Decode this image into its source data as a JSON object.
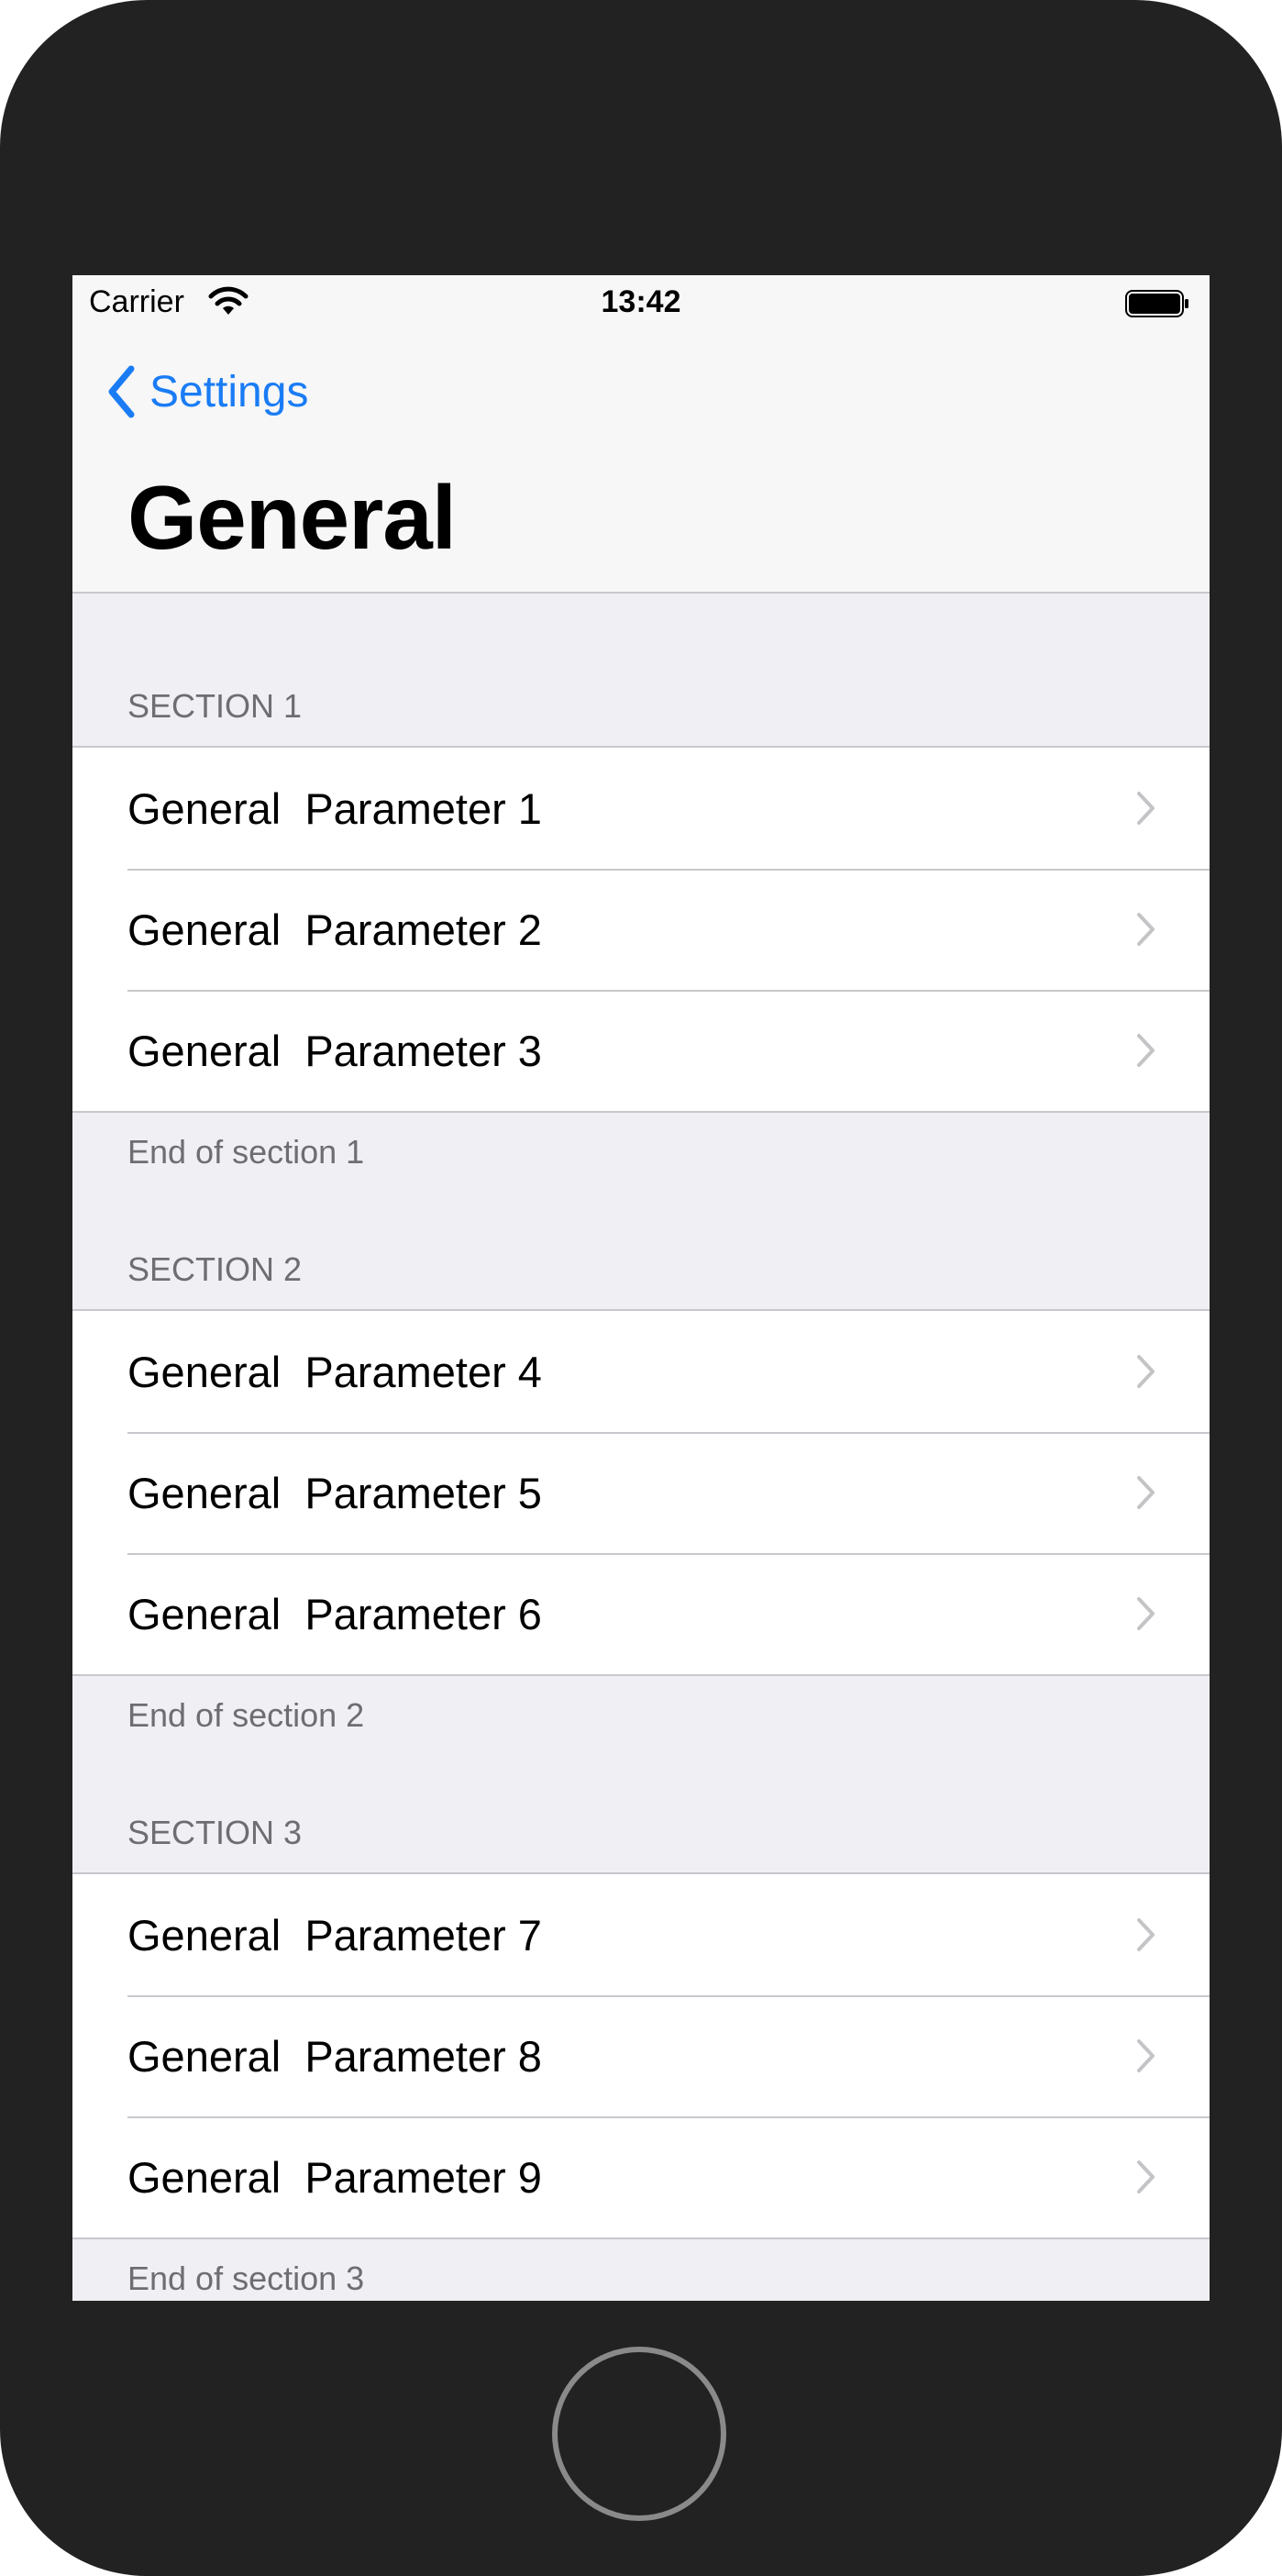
{
  "status_bar": {
    "carrier": "Carrier",
    "time": "13:42"
  },
  "nav": {
    "back_label": "Settings",
    "title": "General"
  },
  "sections": [
    {
      "header": "SECTION 1",
      "items": [
        "General  Parameter 1",
        "General  Parameter 2",
        "General  Parameter 3"
      ],
      "footer": "End of section 1"
    },
    {
      "header": "SECTION 2",
      "items": [
        "General  Parameter 4",
        "General  Parameter 5",
        "General  Parameter 6"
      ],
      "footer": "End of section 2"
    },
    {
      "header": "SECTION 3",
      "items": [
        "General  Parameter 7",
        "General  Parameter 8",
        "General  Parameter 9"
      ],
      "footer": "End of section 3"
    }
  ],
  "colors": {
    "accent": "#1a7cf5",
    "grouped_background": "#efeff4",
    "separator": "#c8c7cc",
    "secondary_text": "#6d6d72",
    "chevron": "#c4c4c7",
    "device_frame": "#222222"
  },
  "icons": {
    "wifi": "wifi-icon",
    "battery": "battery-icon",
    "back": "chevron-left-icon",
    "disclosure": "chevron-right-icon"
  }
}
